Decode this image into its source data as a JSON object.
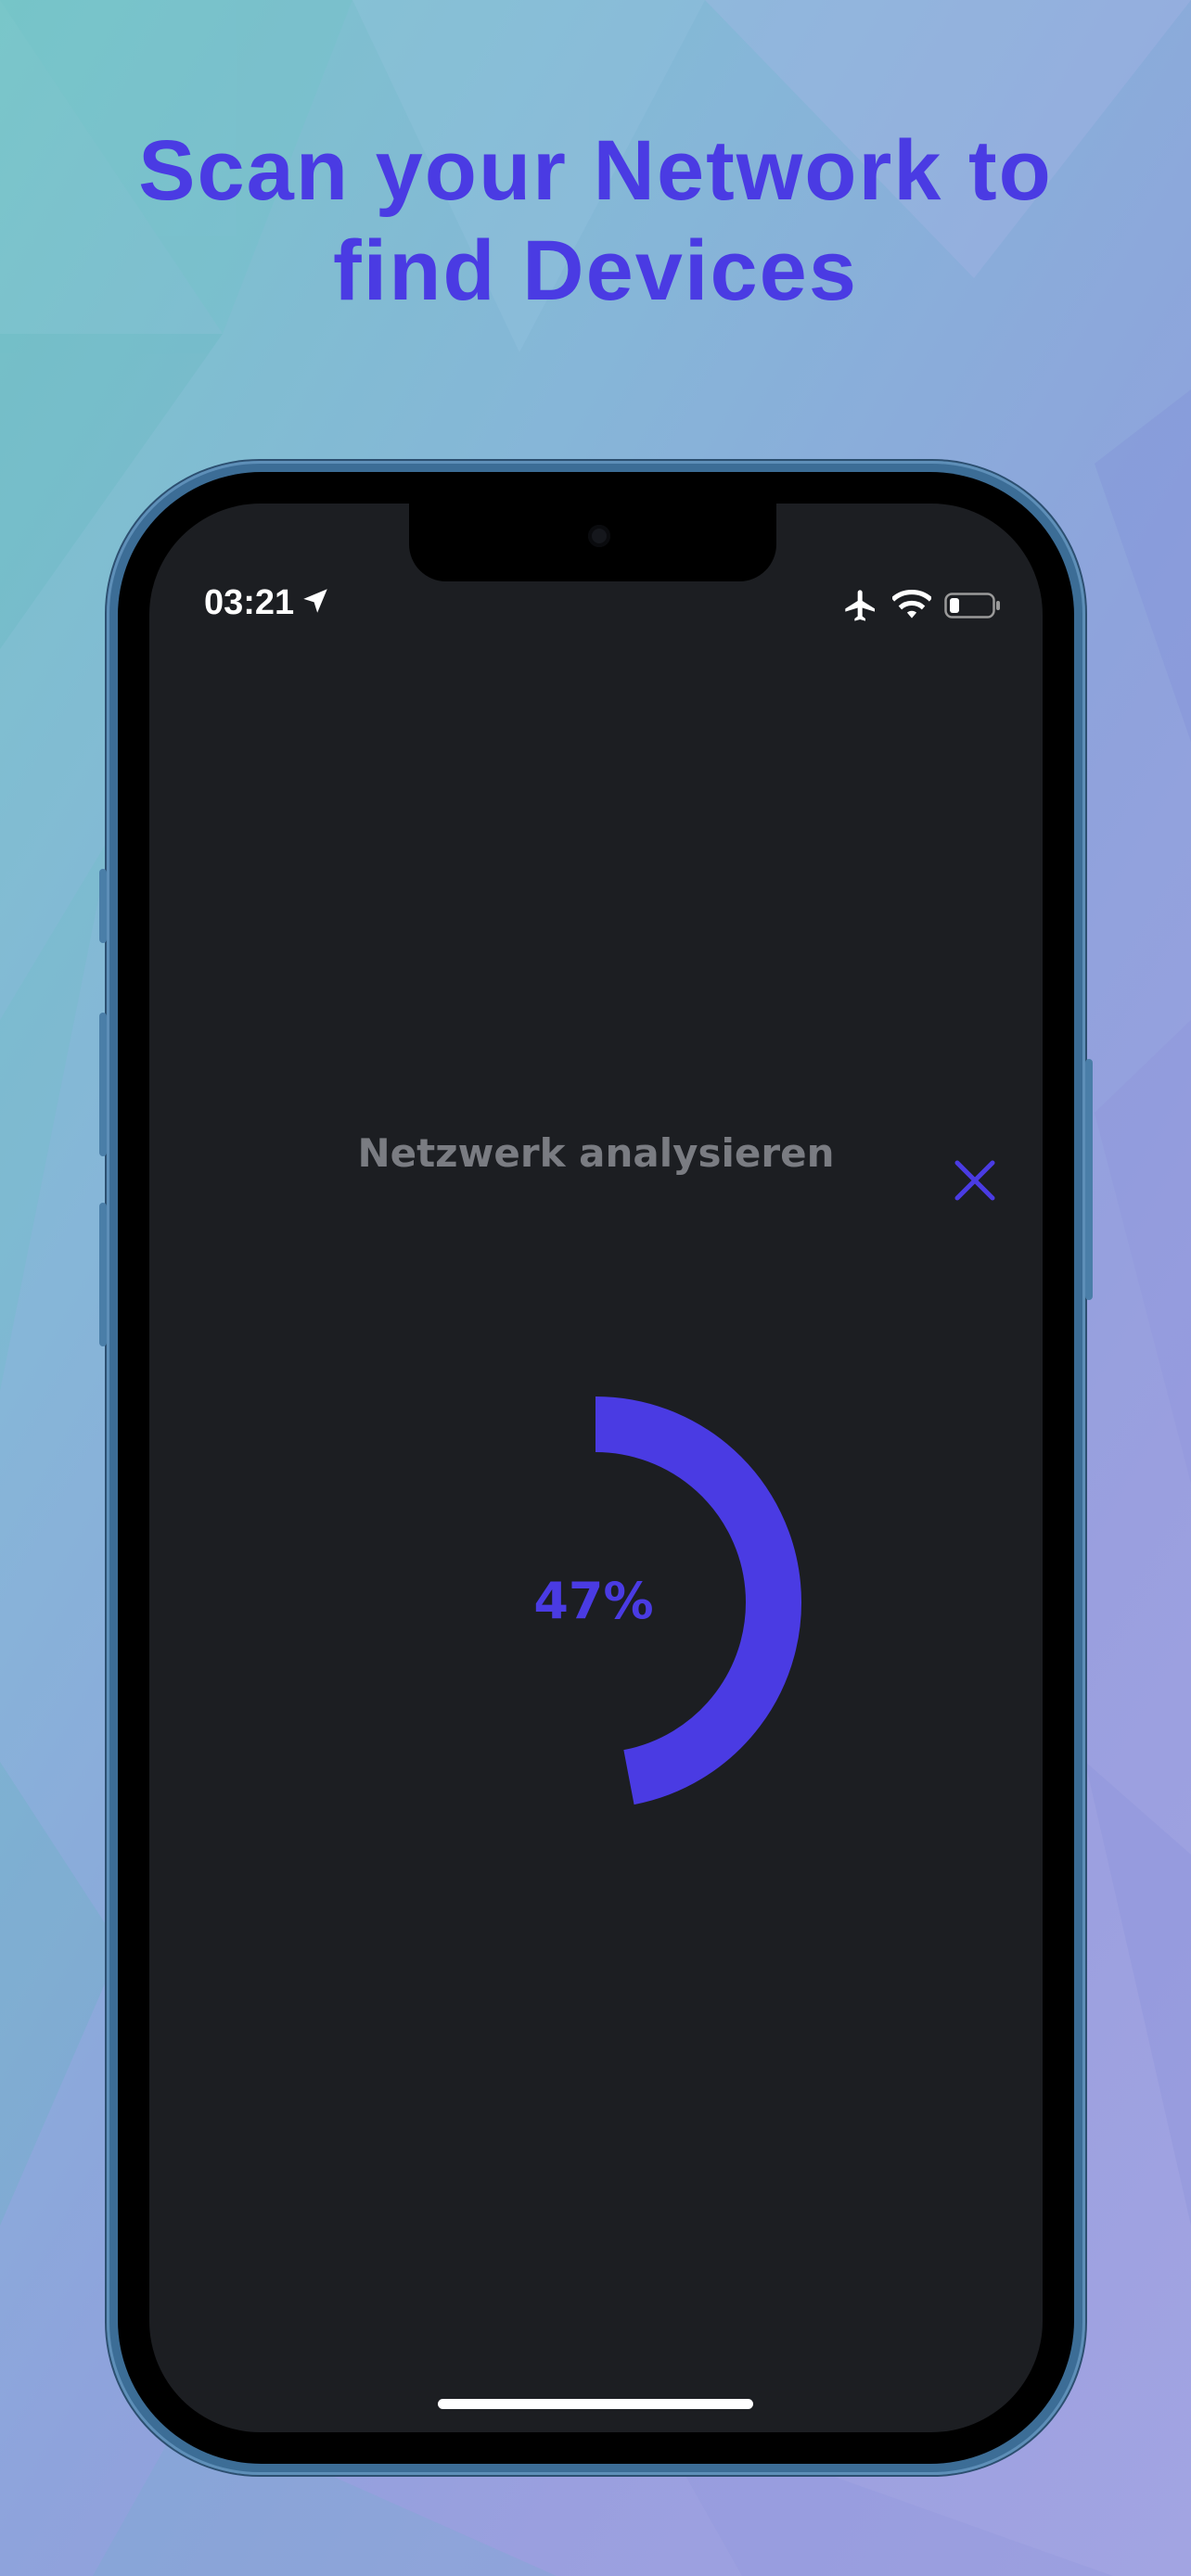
{
  "headline": {
    "line1": "Scan your Network to",
    "line2": "find Devices"
  },
  "status_bar": {
    "time": "03:21",
    "icons": [
      "location-arrow-icon",
      "airplane-icon",
      "wifi-icon",
      "battery-icon"
    ]
  },
  "screen": {
    "title": "Netzwerk analysieren",
    "close_icon": "close-icon",
    "progress_label": "47%",
    "progress_value": 0.47
  },
  "colors": {
    "accent": "#4a3be3",
    "screen_bg": "#1c1e22",
    "title_text": "#7a7c82"
  }
}
